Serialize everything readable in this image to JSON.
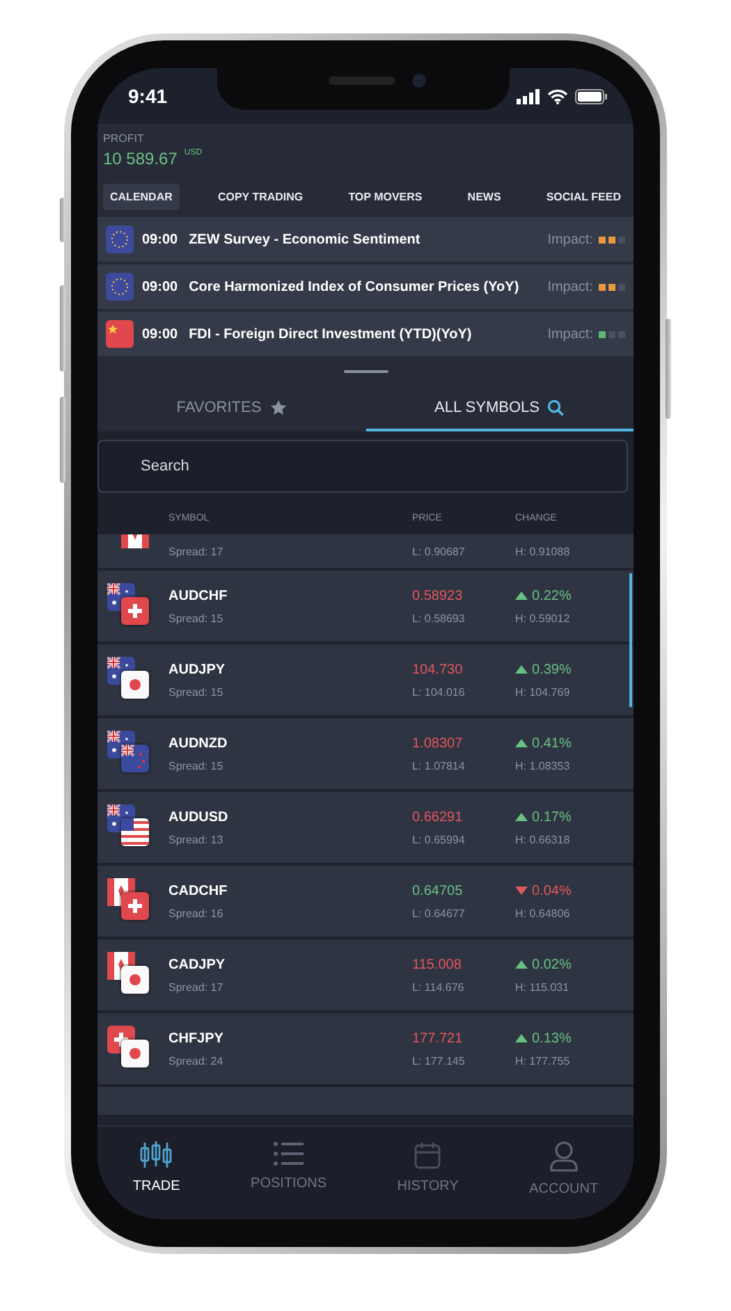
{
  "status_bar": {
    "time": "9:41"
  },
  "profit": {
    "label": "PROFIT",
    "value": "10 589.67",
    "currency": "USD"
  },
  "feed_tabs": [
    {
      "label": "CALENDAR",
      "selected": true
    },
    {
      "label": "COPY TRADING",
      "selected": false
    },
    {
      "label": "TOP MOVERS",
      "selected": false
    },
    {
      "label": "NEWS",
      "selected": false
    },
    {
      "label": "SOCIAL FEED",
      "selected": false
    }
  ],
  "events": [
    {
      "flag": {
        "kind": "eu"
      },
      "time": "09:00",
      "title": "ZEW Survey - Economic Sentiment",
      "impact_label": "Impact:",
      "stars": 2,
      "color": "#e8983f"
    },
    {
      "flag": {
        "kind": "eu"
      },
      "time": "09:00",
      "title": "Core Harmonized Index of Consumer Prices (YoY)",
      "impact_label": "Impact:",
      "stars": 2,
      "color": "#e8983f"
    },
    {
      "flag": {
        "kind": "cn"
      },
      "time": "09:00",
      "title": "FDI - Foreign Direct Investment (YTD)(YoY)",
      "impact_label": "Impact:",
      "stars": 1,
      "color": "#5fb573"
    }
  ],
  "symbol_tabs": [
    {
      "label": "FAVORITES",
      "kind": "star",
      "selected": false
    },
    {
      "label": "ALL SYMBOLS",
      "kind": "search",
      "selected": true
    }
  ],
  "search": {
    "placeholder": "Search"
  },
  "columns": [
    "SYMBOL",
    "PRICE",
    "CHANGE"
  ],
  "partial_top_row": {
    "flag": {
      "kind": "ca"
    },
    "spread": "Spread: 17",
    "low": "L: 0.90687",
    "high": "H: 0.91088"
  },
  "rows": [
    {
      "flags": [
        {
          "kind": "au"
        },
        {
          "kind": "ch"
        }
      ],
      "symbol": "AUDCHF",
      "spread": "Spread: 15",
      "price": {
        "kind": "down",
        "text": "0.58923"
      },
      "low": "L: 0.58693",
      "change": {
        "kind": "up",
        "text": "0.22%"
      },
      "high": "H: 0.59012"
    },
    {
      "flags": [
        {
          "kind": "au"
        },
        {
          "kind": "jp"
        }
      ],
      "symbol": "AUDJPY",
      "spread": "Spread: 15",
      "price": {
        "kind": "down",
        "text": "104.730"
      },
      "low": "L: 104.016",
      "change": {
        "kind": "up",
        "text": "0.39%"
      },
      "high": "H: 104.769"
    },
    {
      "flags": [
        {
          "kind": "au"
        },
        {
          "kind": "nz"
        }
      ],
      "symbol": "AUDNZD",
      "spread": "Spread: 15",
      "price": {
        "kind": "down",
        "text": "1.08307"
      },
      "low": "L: 1.07814",
      "change": {
        "kind": "up",
        "text": "0.41%"
      },
      "high": "H: 1.08353"
    },
    {
      "flags": [
        {
          "kind": "au"
        },
        {
          "kind": "us"
        }
      ],
      "symbol": "AUDUSD",
      "spread": "Spread: 13",
      "price": {
        "kind": "down",
        "text": "0.66291"
      },
      "low": "L: 0.65994",
      "change": {
        "kind": "up",
        "text": "0.17%"
      },
      "high": "H: 0.66318"
    },
    {
      "flags": [
        {
          "kind": "ca"
        },
        {
          "kind": "ch"
        }
      ],
      "symbol": "CADCHF",
      "spread": "Spread: 16",
      "price": {
        "kind": "up",
        "text": "0.64705"
      },
      "low": "L: 0.64677",
      "change": {
        "kind": "down",
        "text": "0.04%"
      },
      "high": "H: 0.64806"
    },
    {
      "flags": [
        {
          "kind": "ca"
        },
        {
          "kind": "jp"
        }
      ],
      "symbol": "CADJPY",
      "spread": "Spread: 17",
      "price": {
        "kind": "down",
        "text": "115.008"
      },
      "low": "L: 114.676",
      "change": {
        "kind": "up",
        "text": "0.02%"
      },
      "high": "H: 115.031"
    },
    {
      "flags": [
        {
          "kind": "ch"
        },
        {
          "kind": "jp"
        }
      ],
      "symbol": "CHFJPY",
      "spread": "Spread: 24",
      "price": {
        "kind": "down",
        "text": "177.721"
      },
      "low": "L: 177.145",
      "change": {
        "kind": "up",
        "text": "0.13%"
      },
      "high": "H: 177.755"
    }
  ],
  "nav": [
    {
      "label": "TRADE",
      "kind": "candles",
      "selected": true
    },
    {
      "label": "POSITIONS",
      "kind": "list",
      "selected": false
    },
    {
      "label": "HISTORY",
      "kind": "calendar",
      "selected": false
    },
    {
      "label": "ACCOUNT",
      "kind": "person",
      "selected": false
    }
  ]
}
